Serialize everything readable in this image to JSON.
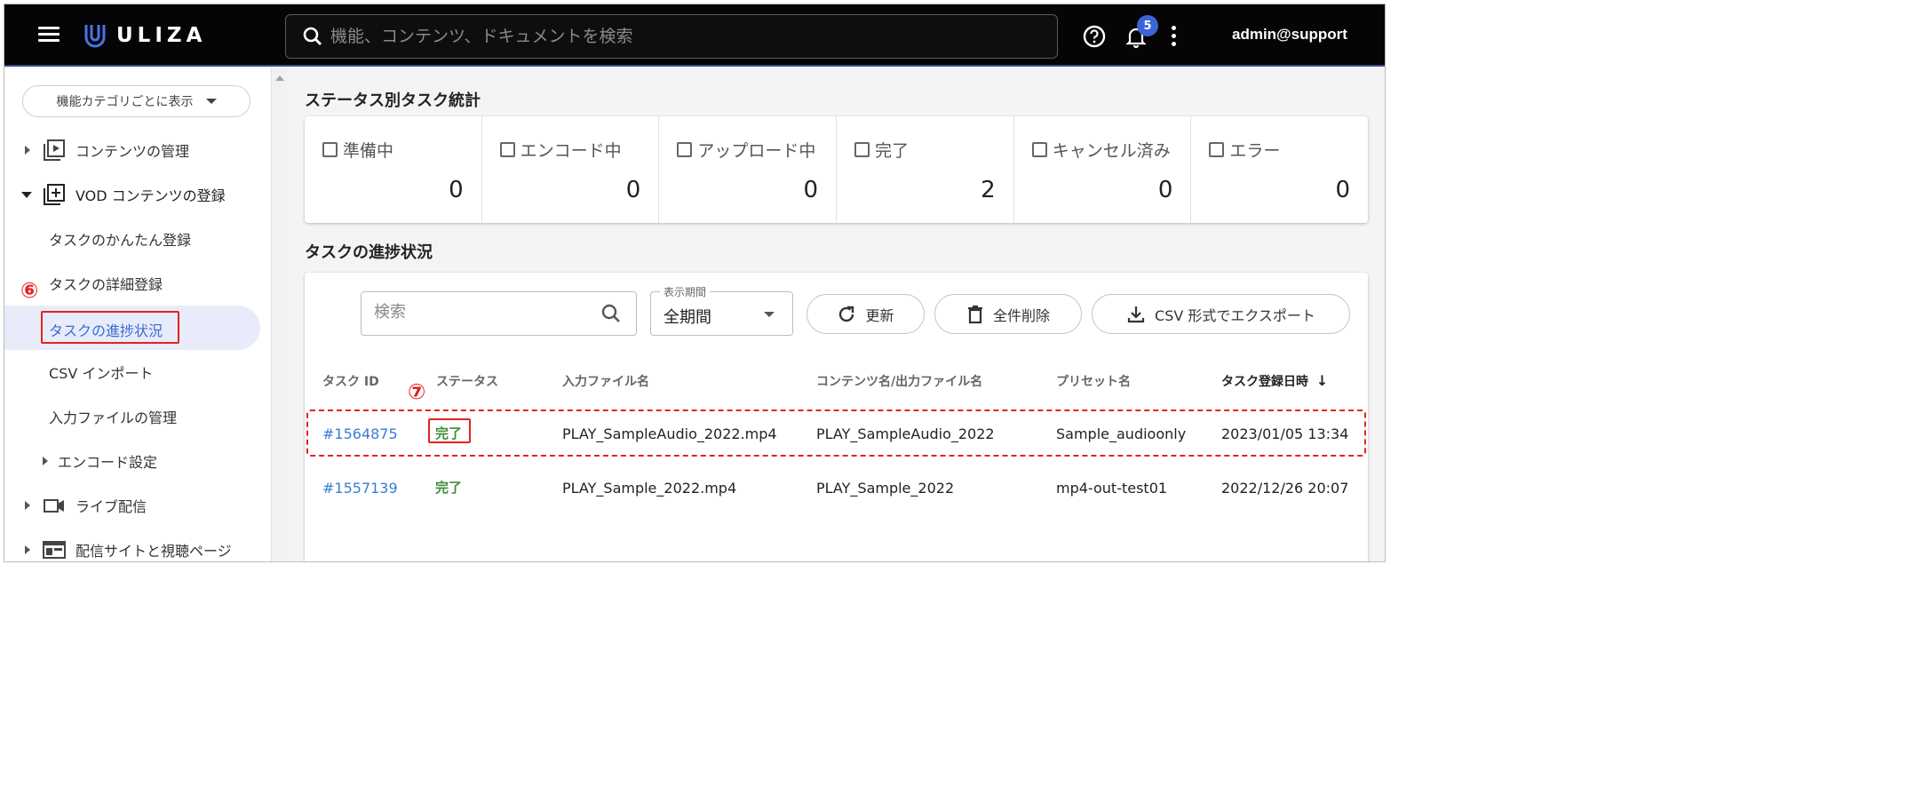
{
  "header": {
    "brand": "ULIZA",
    "search_placeholder": "機能、コンテンツ、ドキュメントを検索",
    "notification_count": "5",
    "user": "admin@support"
  },
  "sidebar": {
    "category_button": "機能カテゴリごとに表示",
    "items": [
      {
        "label": "コンテンツの管理"
      },
      {
        "label": "VOD コンテンツの登録"
      },
      {
        "label": "タスクのかんたん登録"
      },
      {
        "label": "タスクの詳細登録"
      },
      {
        "label": "タスクの進捗状況"
      },
      {
        "label": "CSV インポート"
      },
      {
        "label": "入力ファイルの管理"
      },
      {
        "label": "エンコード設定"
      },
      {
        "label": "ライブ配信"
      },
      {
        "label": "配信サイトと視聴ページ"
      }
    ]
  },
  "annotations": {
    "step6": "⑥",
    "step7": "⑦"
  },
  "stats": {
    "title": "ステータス別タスク統計",
    "items": [
      {
        "label": "準備中",
        "value": "0"
      },
      {
        "label": "エンコード中",
        "value": "0"
      },
      {
        "label": "アップロード中",
        "value": "0"
      },
      {
        "label": "完了",
        "value": "2"
      },
      {
        "label": "キャンセル済み",
        "value": "0"
      },
      {
        "label": "エラー",
        "value": "0"
      }
    ]
  },
  "progress": {
    "title": "タスクの進捗状況",
    "search_placeholder": "検索",
    "period_label": "表示期間",
    "period_value": "全期間",
    "refresh": "更新",
    "delete_all": "全件削除",
    "export_csv": "CSV 形式でエクスポート",
    "columns": [
      "タスク ID",
      "ステータス",
      "入力ファイル名",
      "コンテンツ名/出力ファイル名",
      "プリセット名",
      "タスク登録日時"
    ],
    "rows": [
      {
        "id": "#1564875",
        "status": "完了",
        "input": "PLAY_SampleAudio_2022.mp4",
        "content": "PLAY_SampleAudio_2022",
        "preset": "Sample_audioonly",
        "date": "2023/01/05 13:34"
      },
      {
        "id": "#1557139",
        "status": "完了",
        "input": "PLAY_Sample_2022.mp4",
        "content": "PLAY_Sample_2022",
        "preset": "mp4-out-test01",
        "date": "2022/12/26 20:07"
      }
    ]
  },
  "colors": {
    "topbar": "#050505",
    "accent": "#3b6bd6",
    "success": "#3f8f3a",
    "annotation": "#e32222"
  }
}
